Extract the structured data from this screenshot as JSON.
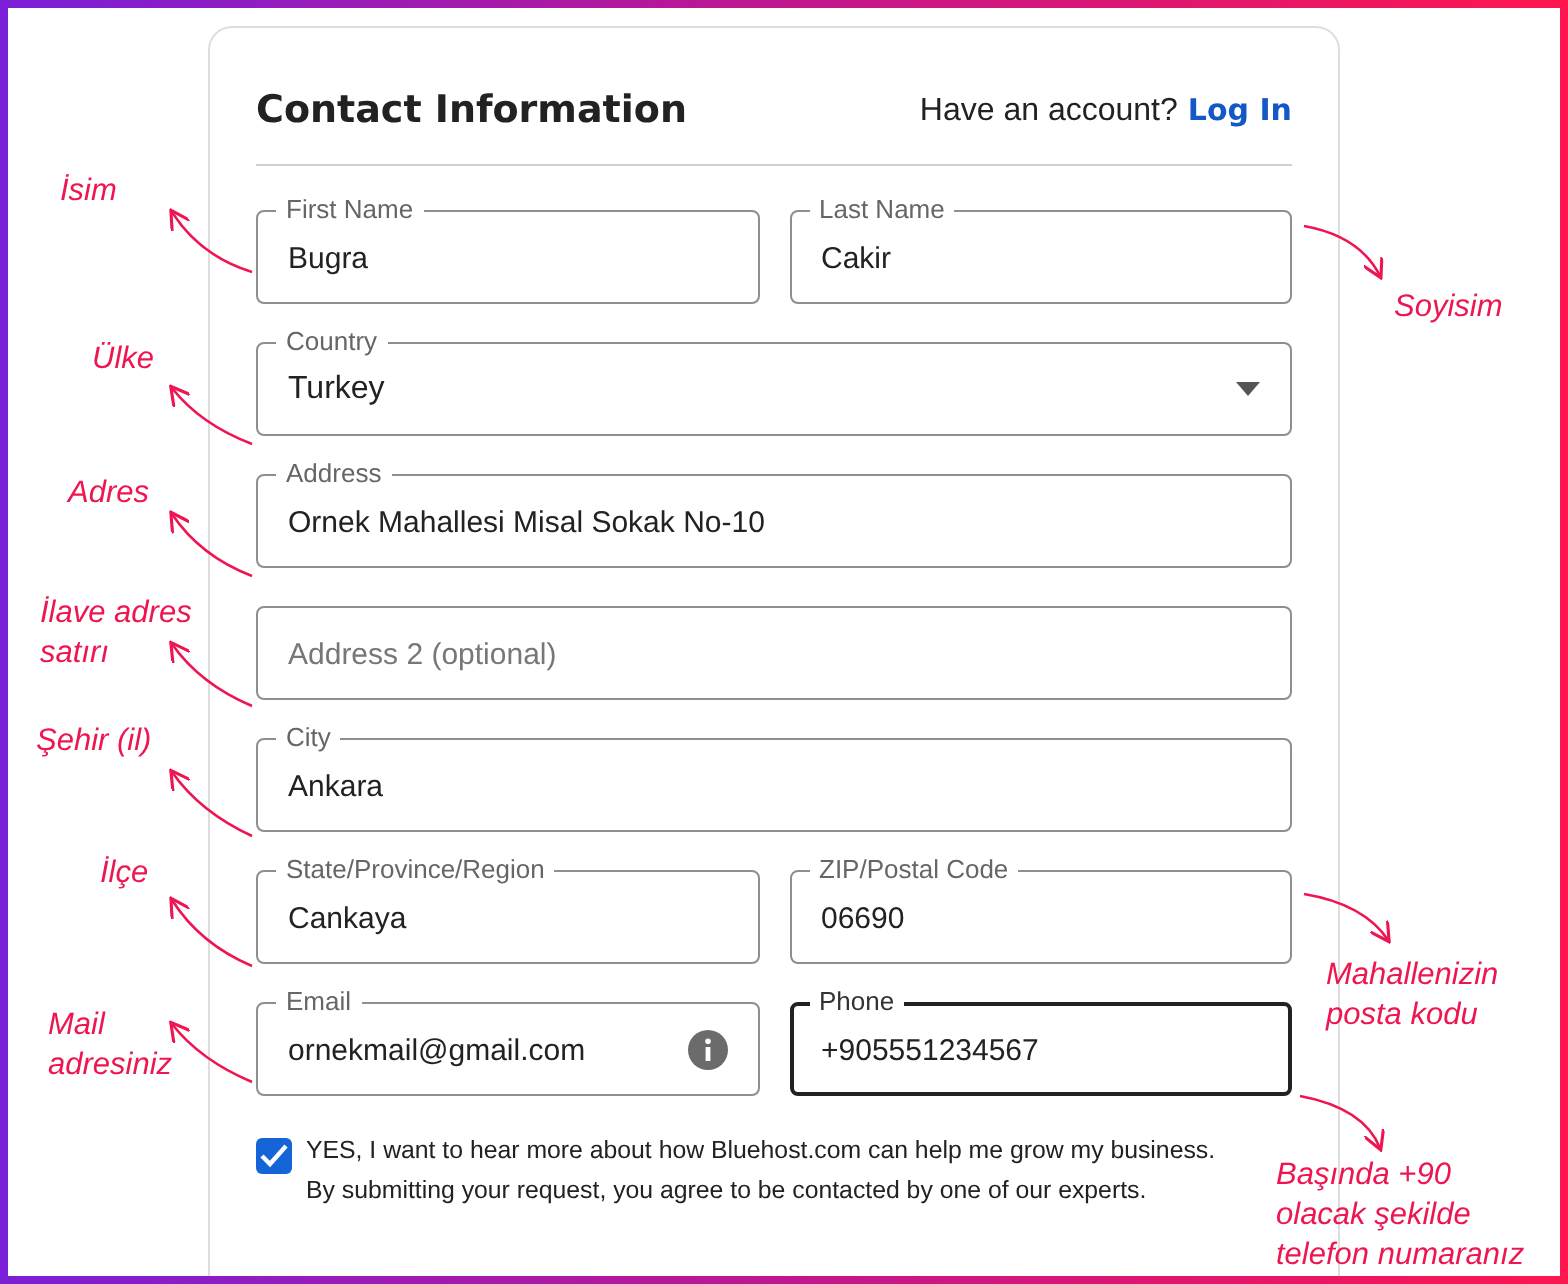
{
  "header": {
    "title": "Contact Information",
    "account_prompt": "Have an account?",
    "login_link": "Log In"
  },
  "field_rows": [
    {
      "fields": [
        {
          "kind": "text",
          "label": "First Name",
          "value": "Bugra",
          "focused": false
        },
        {
          "kind": "text",
          "label": "Last Name",
          "value": "Cakir",
          "focused": false
        }
      ]
    },
    {
      "fields": [
        {
          "kind": "select",
          "label": "Country",
          "value": "Turkey",
          "focused": false
        }
      ]
    },
    {
      "fields": [
        {
          "kind": "text",
          "label": "Address",
          "value": "Ornek Mahallesi Misal Sokak No-10",
          "focused": false
        }
      ]
    },
    {
      "fields": [
        {
          "kind": "text",
          "placeholder": "Address 2 (optional)",
          "focused": false
        }
      ]
    },
    {
      "fields": [
        {
          "kind": "text",
          "label": "City",
          "value": "Ankara",
          "focused": false
        }
      ]
    },
    {
      "fields": [
        {
          "kind": "text",
          "label": "State/Province/Region",
          "value": "Cankaya",
          "focused": false
        },
        {
          "kind": "text",
          "label": "ZIP/Postal Code",
          "value": "06690",
          "focused": false
        }
      ]
    },
    {
      "fields": [
        {
          "kind": "info",
          "label": "Email",
          "value": "ornekmail@gmail.com",
          "focused": false
        },
        {
          "kind": "text",
          "label": "Phone",
          "value": "+905551234567",
          "focused": true
        }
      ]
    }
  ],
  "consent": {
    "checked": true,
    "text": "YES, I want to hear more about how Bluehost.com can help me grow my business.",
    "note": "By submitting your request, you agree to be contacted by one of our experts."
  },
  "annotations_left": [
    {
      "text": "İsim"
    },
    {
      "text": "Ülke"
    },
    {
      "text": "Adres"
    },
    {
      "text": "İlave adres satırı"
    },
    {
      "text": "Şehir (il)"
    },
    {
      "text": "İlçe"
    },
    {
      "text": "Mail adresiniz"
    }
  ],
  "annotations_right": [
    {
      "text": "Soyisim"
    },
    {
      "text": "Mahallenizin posta kodu"
    },
    {
      "text": "Başında +90 olacak şekilde telefon numaranız"
    }
  ]
}
